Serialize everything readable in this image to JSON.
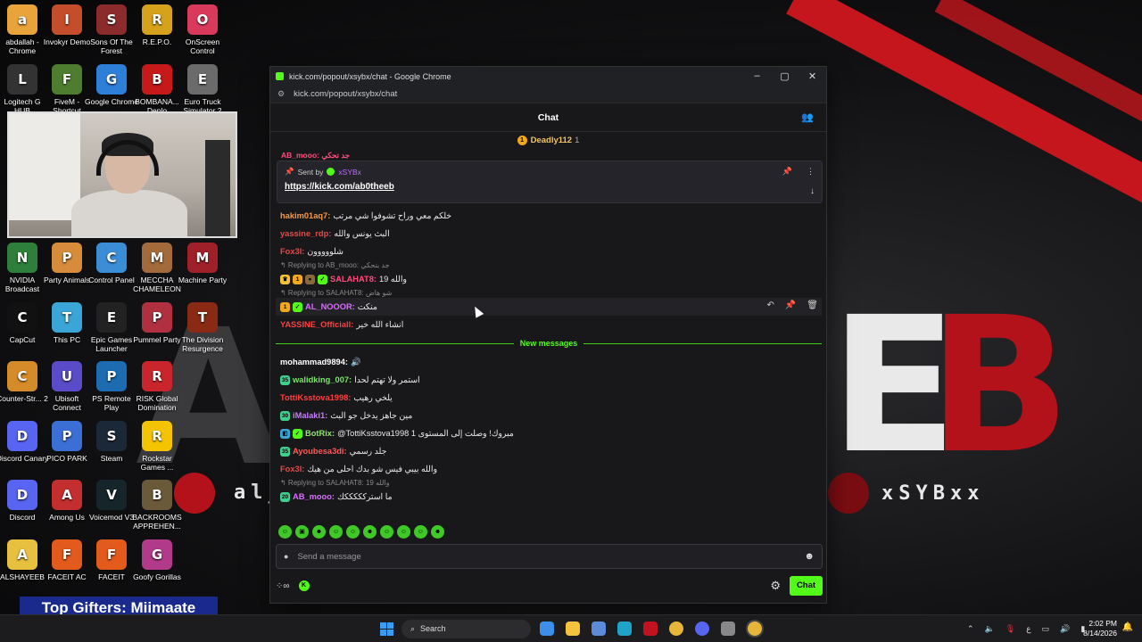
{
  "window": {
    "title": "kick.com/popout/xsybx/chat - Google Chrome",
    "url": "kick.com/popout/xsybx/chat",
    "controls": [
      "–",
      "▢",
      "✕"
    ]
  },
  "chat": {
    "header_title": "Chat",
    "top_gifter": {
      "name": "Deadly112",
      "count": "1"
    },
    "pinned": {
      "sent_by_label": "Sent by",
      "sender": "xSYBx",
      "link": "https://kick.com/ab0theeb",
      "partial_top": "AB_mooo: جد تحكي"
    },
    "messages": [
      {
        "user": "hakim01aq7:",
        "text": "خلكم معي وراح تشوفوا شي مرتب",
        "color": "#f49a4b"
      },
      {
        "user": "yassine_rdp:",
        "text": "البث يونس والله",
        "color": "#e14b4b"
      },
      {
        "user": "Fox3I:",
        "text": "شلووووون",
        "color": "#e14b4b"
      },
      {
        "reply": "Replying to AB_mooo: جد بتحكي",
        "user": "SALAHAT8:",
        "text": "والله 19",
        "color": "#ff4c7d",
        "badges": [
          "crown",
          "1",
          "o",
          "v"
        ]
      },
      {
        "reply": "Replying to SALAHAT8: شو هاض",
        "user": "AL_NOOOR:",
        "text": "منكت",
        "color": "#d86cff",
        "badges": [
          "1",
          "v"
        ],
        "hover": true
      },
      {
        "user": "YASSINE_Officiall:",
        "text": "انشاء الله خير",
        "color": "#ff3f3f"
      }
    ],
    "new_messages_label": "New messages",
    "new": [
      {
        "user": "mohammad9894:",
        "text": "🔊",
        "color": "#ffffff"
      },
      {
        "user": "walidking_007:",
        "text": "استمر ولا تهتم لحدا",
        "color": "#7be36b",
        "badges": [
          "35"
        ]
      },
      {
        "user": "TottiKsstova1998:",
        "text": "يلخي رهيب",
        "color": "#ff3f3f"
      },
      {
        "user": "iMalaki1:",
        "text": "مين جاهز يدخل جو البث",
        "color": "#c77dff",
        "badges": [
          "30"
        ]
      },
      {
        "user": "BotRix:",
        "text": "@TottiKsstova1998 مبروك! وصلت إلى المستوى 1",
        "color": "#8ee76c",
        "badges": [
          "bot",
          "v"
        ]
      },
      {
        "user": "Ayoubesa3di:",
        "text": "جلد رسمي",
        "color": "#ff5a5a",
        "badges": [
          "35"
        ]
      },
      {
        "user": "Fox3I:",
        "text": "والله بيبي فيس شو بدك احلى من هيك",
        "color": "#e14b4b"
      },
      {
        "reply": "Replying to SALAHAT8: والله 19",
        "user": "AB_mooo:",
        "text": "ما استركككككك",
        "color": "#d86cff",
        "badges": [
          "20"
        ]
      }
    ],
    "input_placeholder": "Send a message",
    "send_label": "Chat"
  },
  "desktop_icons": [
    "abdallah - Chrome",
    "Invokyr Demo",
    "Sons Of The Forest",
    "R.E.P.O.",
    "OnScreen Control",
    "Logitech G HUB",
    "FiveM - Shortcut",
    "Google Chrome",
    "BOMBANA... Deplo",
    "Euro Truck Simulator 2",
    "NVIDIA Broadcast",
    "Party Animals",
    "Control Panel",
    "MECCHA CHAMELEON",
    "Machine Party",
    "CapCut",
    "This PC",
    "Epic Games Launcher",
    "Pummel Party",
    "The Division Resurgence",
    "Counter-Str... 2",
    "Ubisoft Connect",
    "PS Remote Play",
    "RISK Global Domination",
    "Discord Canary",
    "PICO PARK",
    "Steam",
    "Rockstar Games ...",
    "Discord",
    "Among Us",
    "Voicemod V3",
    "BACKROOMS APPREHEN...",
    "ALSHAYEEB",
    "FACEIT AC",
    "FACEIT",
    "Goofy Gorillas"
  ],
  "wallpaper": {
    "handle": "xSYBxx",
    "partial_text": "al_",
    "letters": [
      "E",
      "B"
    ]
  },
  "top_gifters": "Top Gifters: Miimaate",
  "taskbar": {
    "search": "Search",
    "time": "2:02 PM",
    "date": "8/14/2026",
    "lang": "ع"
  },
  "colors": {
    "kick_green": "#53fc18",
    "wallpaper_red": "#c4161c"
  }
}
